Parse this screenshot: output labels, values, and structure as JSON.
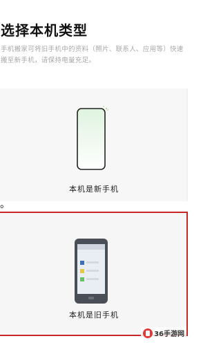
{
  "header": {
    "title": "选择本机类型",
    "description": "手机搬家可将旧手机中的资料（照片、联系人、应用等）快速搬至新手机，请保持电量充足。"
  },
  "options": [
    {
      "label": "本机是新手机",
      "selected": false
    },
    {
      "label": "本机是旧手机",
      "selected": true
    }
  ],
  "edge_mark": "。",
  "watermark": {
    "text": "36手游网"
  },
  "colors": {
    "selected_border": "#c62828",
    "card_background": "#f7f7f7",
    "phone_screen_gradient": "#d9f2d9"
  },
  "icons": {
    "new_phone": "new-phone-outline-icon",
    "old_phone": "old-phone-dark-icon"
  }
}
